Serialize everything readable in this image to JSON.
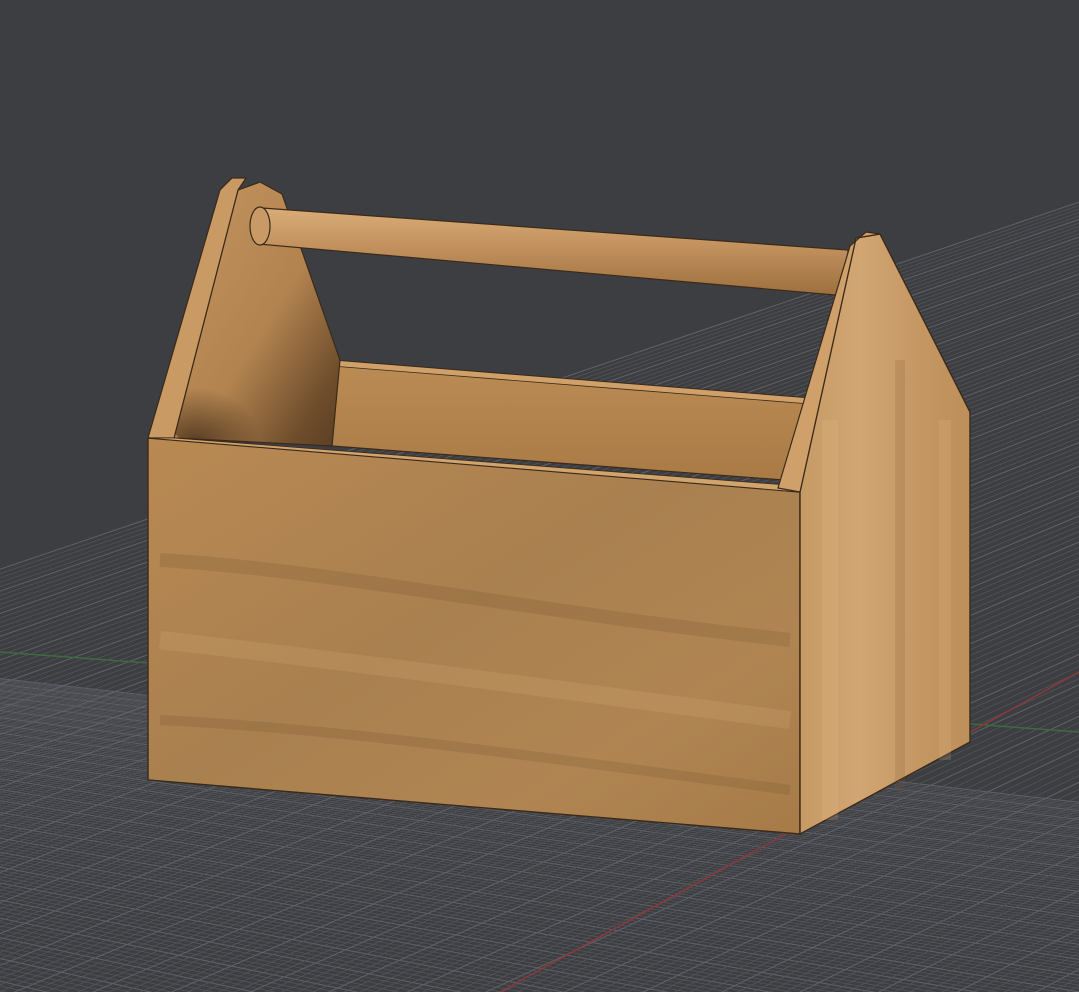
{
  "viewport": {
    "name": "3d-viewport",
    "background_color": "#3d3e42",
    "grid_color_minor": "#55575c",
    "grid_color_major": "#60626a",
    "axis_x_color": "#8a3a3a",
    "axis_y_color": "#3d6b3d"
  },
  "model": {
    "object": "wooden-tool-tote",
    "parts": [
      "front-panel",
      "right-end-panel",
      "left-end-panel",
      "back-panel",
      "dowel-handle"
    ],
    "wood_light": "#c7975f",
    "wood_mid": "#b5854f",
    "wood_dark": "#8f6536",
    "edge_color": "#3a2a1a"
  }
}
